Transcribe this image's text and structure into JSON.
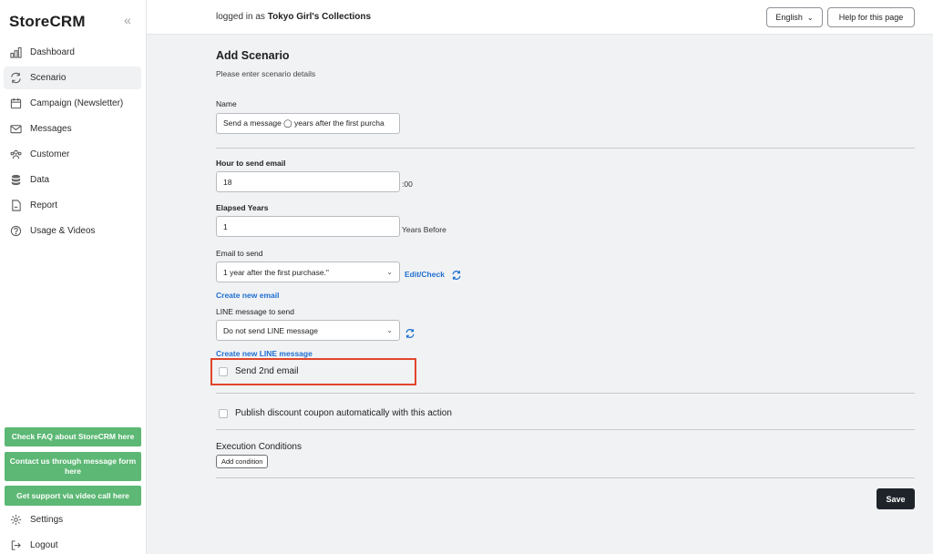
{
  "sidebar": {
    "brand": "StoreCRM",
    "collapse_glyph": "«",
    "items": [
      {
        "label": "Dashboard",
        "icon": "chart-bar-icon"
      },
      {
        "label": "Scenario",
        "icon": "sync-icon",
        "active": true
      },
      {
        "label": "Campaign (Newsletter)",
        "icon": "calendar-icon"
      },
      {
        "label": "Messages",
        "icon": "envelope-icon"
      },
      {
        "label": "Customer",
        "icon": "users-icon"
      },
      {
        "label": "Data",
        "icon": "database-icon"
      },
      {
        "label": "Report",
        "icon": "document-icon"
      },
      {
        "label": "Usage & Videos",
        "icon": "question-circle-icon"
      }
    ],
    "support_buttons": [
      "Check FAQ about StoreCRM here",
      "Contact us through message form here",
      "Get support via video call here"
    ],
    "settings_label": "Settings",
    "logout_label": "Logout",
    "support_color": "#5cb874"
  },
  "topbar": {
    "logged_prefix": "logged in as",
    "account_name": "Tokyo Girl's Collections",
    "language": "English",
    "help_label": "Help for this page"
  },
  "form": {
    "title": "Add Scenario",
    "subtitle": "Please enter scenario details",
    "name_label": "Name",
    "name_value": "Send a message ◯ years after the first purcha",
    "hour_label": "Hour to send email",
    "hour_value": "18",
    "hour_suffix": ":00",
    "years_label": "Elapsed Years",
    "years_value": "1",
    "years_suffix": "Years Before",
    "email_label": "Email to send",
    "email_value": "1 year after the first purchase.\"",
    "edit_check_label": "Edit/Check",
    "create_email_label": "Create new email",
    "line_label": "LINE message to send",
    "line_value": "Do not send LINE message",
    "create_line_label": "Create new LINE message",
    "second_email_label": "Send 2nd email",
    "coupon_label": "Publish discount coupon automatically with this action",
    "conditions_title": "Execution Conditions",
    "add_condition_label": "Add condition",
    "save_label": "Save"
  },
  "colors": {
    "accent_link": "#1f6fd1",
    "highlight_box": "#e1452b",
    "save_button": "#1f242b"
  }
}
